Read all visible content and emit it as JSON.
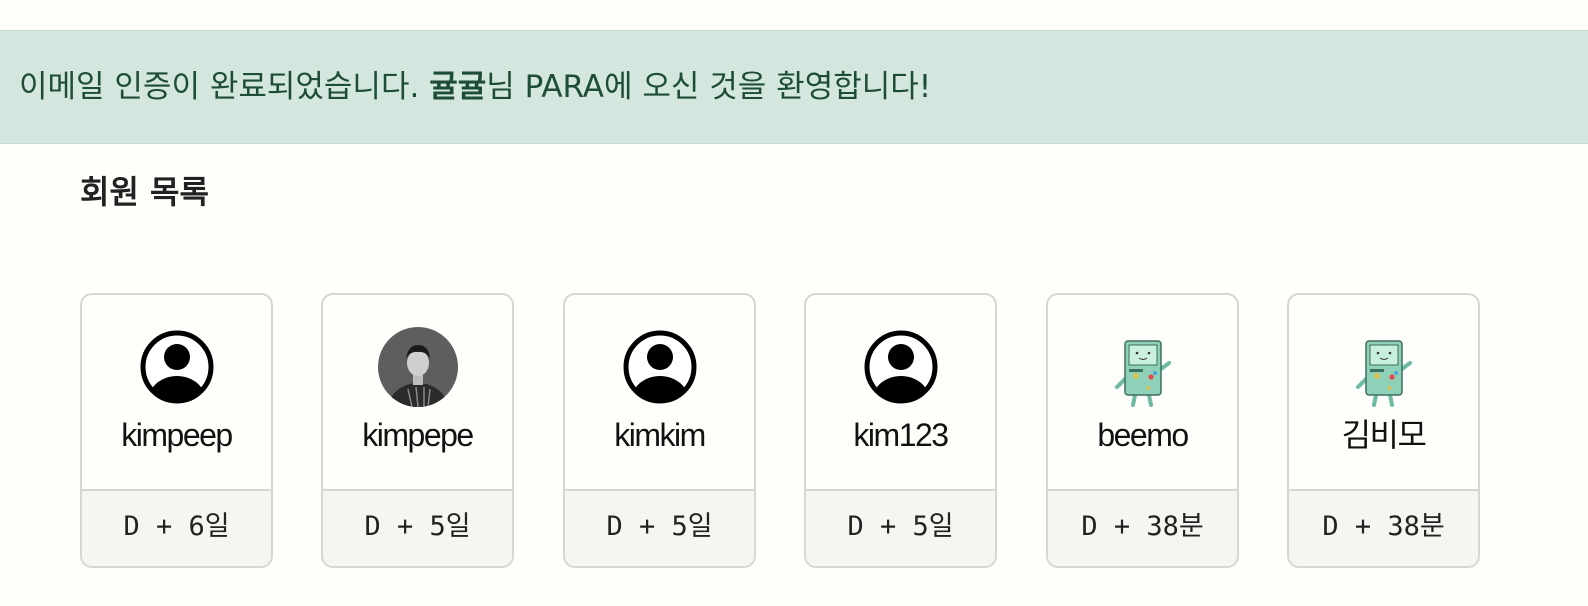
{
  "alert": {
    "prefix": "이메일 인증이 완료되었습니다. ",
    "username": "귤귤",
    "suffix": "님 PARA에 오신 것을 환영합니다!"
  },
  "members_title": "회원 목록",
  "members": [
    {
      "name": "kimpeep",
      "since": "D + 6일",
      "avatar": "default-user-icon"
    },
    {
      "name": "kimpepe",
      "since": "D + 5일",
      "avatar": "profile-photo"
    },
    {
      "name": "kimkim",
      "since": "D + 5일",
      "avatar": "default-user-icon"
    },
    {
      "name": "kim123",
      "since": "D + 5일",
      "avatar": "default-user-icon"
    },
    {
      "name": "beemo",
      "since": "D + 38분",
      "avatar": "bmo-character"
    },
    {
      "name": "김비모",
      "since": "D + 38분",
      "avatar": "bmo-character"
    }
  ],
  "colors": {
    "alert_bg": "#d4e7df",
    "alert_text": "#1e4d36",
    "card_border": "#d6d6d4",
    "footer_bg": "#f5f5f1"
  }
}
